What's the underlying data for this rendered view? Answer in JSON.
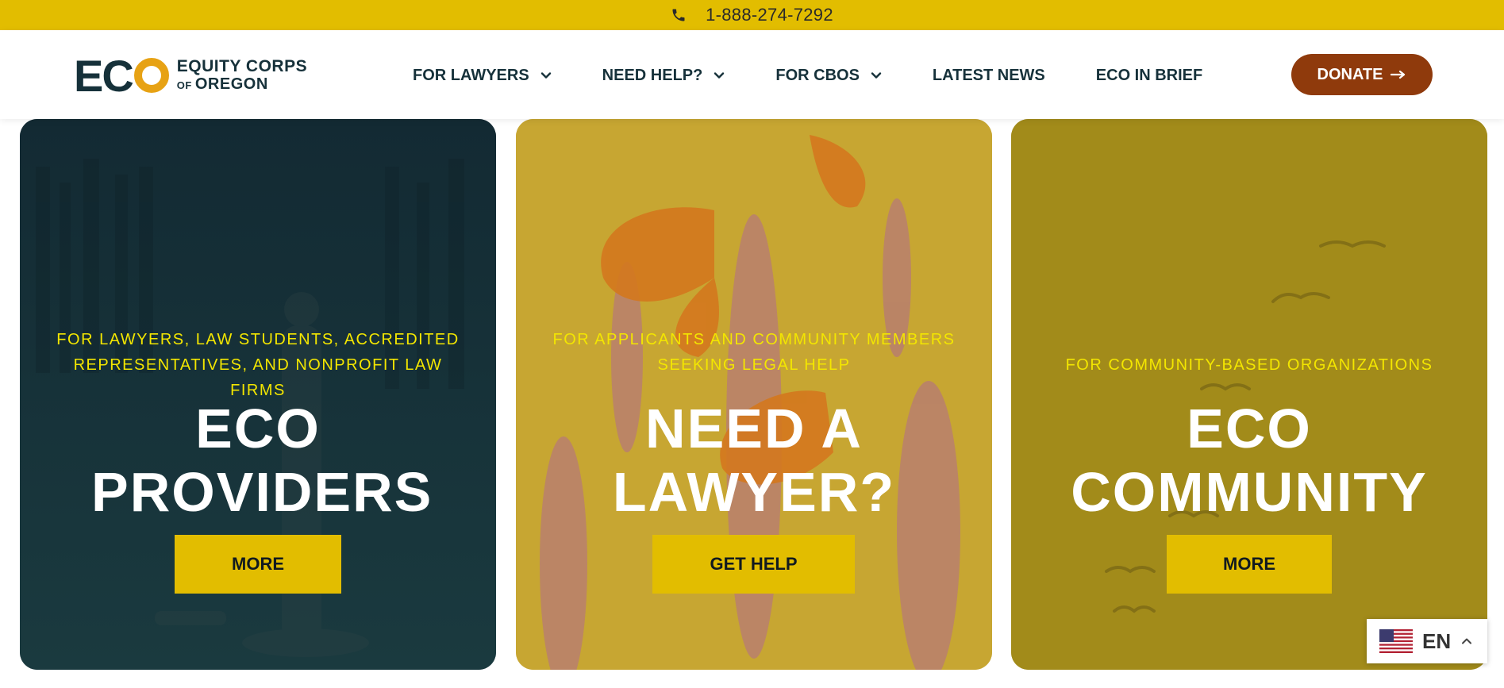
{
  "topbar": {
    "phone": "1-888-274-7292",
    "phone_icon": "phone-icon"
  },
  "header": {
    "logo": {
      "mark_letters": "EC",
      "line1": "EQUITY CORPS",
      "line2_prefix": "OF",
      "line2": "OREGON"
    },
    "nav": [
      {
        "label": "FOR LAWYERS",
        "has_dropdown": true
      },
      {
        "label": "NEED HELP?",
        "has_dropdown": true
      },
      {
        "label": "FOR CBOS",
        "has_dropdown": true
      },
      {
        "label": "LATEST NEWS",
        "has_dropdown": false
      },
      {
        "label": "ECO IN BRIEF",
        "has_dropdown": false
      }
    ],
    "donate_label": "DONATE",
    "donate_icon": "arrow-right-icon"
  },
  "cards": [
    {
      "eyebrow": "FOR LAWYERS, LAW STUDENTS, ACCREDITED REPRESENTATIVES, AND NONPROFIT LAW FIRMS",
      "heading": "ECO PROVIDERS",
      "cta": "MORE"
    },
    {
      "eyebrow": "FOR APPLICANTS AND COMMUNITY MEMBERS SEEKING LEGAL HELP",
      "heading": "NEED A LAWYER?",
      "cta": "GET HELP"
    },
    {
      "eyebrow": "FOR COMMUNITY-BASED ORGANIZATIONS",
      "heading": "ECO COMMUNITY",
      "cta": "MORE"
    }
  ],
  "language": {
    "code": "EN",
    "flag_icon": "us-flag-icon"
  },
  "colors": {
    "topbar": "#e2bd00",
    "navy": "#16313a",
    "donate": "#8f3a0c",
    "card_cta": "#e2bd00",
    "eyebrow": "#f3e600"
  }
}
